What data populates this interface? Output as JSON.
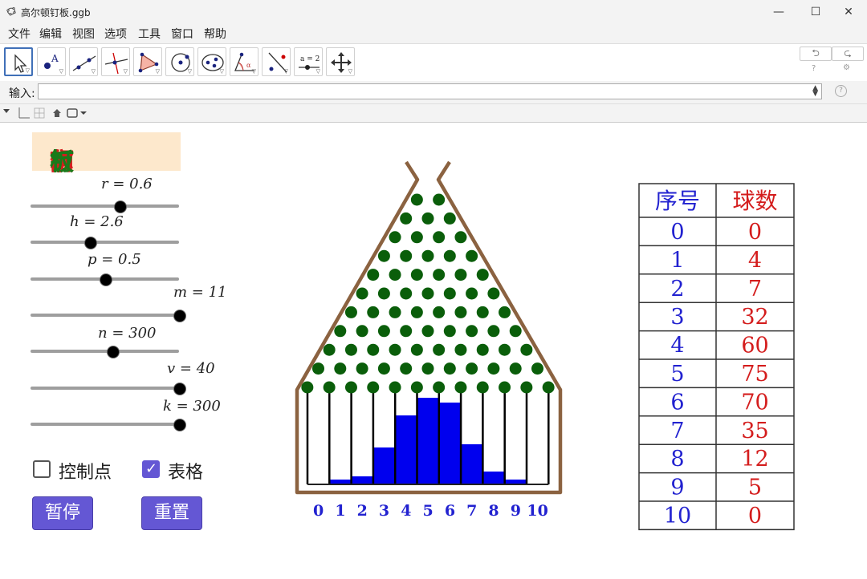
{
  "window": {
    "title": "高尔顿钉板.ggb",
    "minimize": "—",
    "maximize": "☐",
    "close": "✕"
  },
  "menu": [
    "文件",
    "编辑",
    "视图",
    "选项",
    "工具",
    "窗口",
    "帮助"
  ],
  "toolbar": {
    "tools": [
      "move-tool",
      "point-tool",
      "line-tool",
      "perpendicular-tool",
      "polygon-tool",
      "circle-tool",
      "conic-tool",
      "angle-tool",
      "reflect-tool",
      "slider-tool",
      "move-view-tool"
    ],
    "slider_tool_text": "a = 2",
    "undo": "⮌",
    "redo": "⮎",
    "help_glyph": "?",
    "settings_glyph": "⚙"
  },
  "input_bar": {
    "label": "输入:",
    "value": "",
    "help_glyph": "?"
  },
  "sheet": {
    "title": {
      "chars": [
        "高",
        "尔",
        "顿",
        "钉",
        "板"
      ],
      "colors": [
        "#d41d1d",
        "#d41d1d",
        "#d41d1d",
        "#1a7a1a",
        "#1a7a1a"
      ]
    },
    "sliders": [
      {
        "label": "r = 0.6",
        "value": 0.6,
        "fraction": 0.6
      },
      {
        "label": "h = 2.6",
        "value": 2.6,
        "fraction": 0.4
      },
      {
        "label": "p = 0.5",
        "value": 0.5,
        "fraction": 0.5
      },
      {
        "label": "m = 11",
        "value": 11,
        "fraction": 1.0
      },
      {
        "label": "n = 300",
        "value": 300,
        "fraction": 0.55
      },
      {
        "label": "v = 40",
        "value": 40,
        "fraction": 1.0
      },
      {
        "label": "k = 300",
        "value": 300,
        "fraction": 1.0
      }
    ],
    "checkboxes": [
      {
        "label": "控制点",
        "checked": false
      },
      {
        "label": "表格",
        "checked": true
      }
    ],
    "buttons": {
      "pause": "暂停",
      "reset": "重置"
    },
    "board": {
      "peg_color": "#0a5e0a",
      "frame_color": "#8b6240",
      "bar_color": "#0000ee",
      "bin_labels": [
        "0",
        "1",
        "2",
        "3",
        "4",
        "5",
        "6",
        "7",
        "8",
        "9",
        "10"
      ],
      "bar_heights": [
        0,
        0.03,
        0.05,
        0.23,
        0.43,
        0.54,
        0.51,
        0.25,
        0.08,
        0.03,
        0
      ]
    },
    "table": {
      "headers": [
        "序号",
        "球数"
      ],
      "header_colors": [
        "#2222d0",
        "#d41d1d"
      ],
      "rows": [
        [
          "0",
          "0"
        ],
        [
          "1",
          "4"
        ],
        [
          "2",
          "7"
        ],
        [
          "3",
          "32"
        ],
        [
          "4",
          "60"
        ],
        [
          "5",
          "75"
        ],
        [
          "6",
          "70"
        ],
        [
          "7",
          "35"
        ],
        [
          "8",
          "12"
        ],
        [
          "9",
          "5"
        ],
        [
          "10",
          "0"
        ]
      ]
    }
  }
}
